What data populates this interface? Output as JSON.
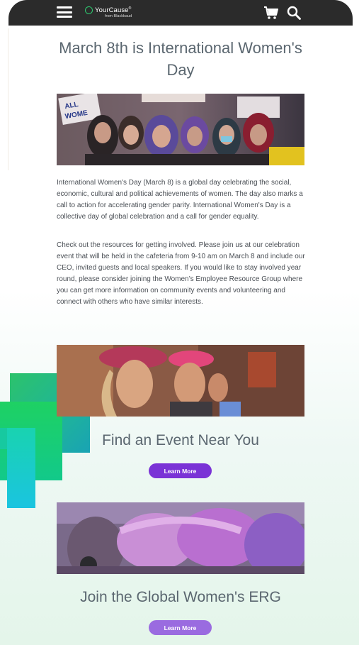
{
  "header": {
    "logo_main": "YourCause",
    "logo_reg": "®",
    "logo_sub": "from Blackbaud",
    "menu_icon": "hamburger-icon",
    "cart_icon": "cart-icon",
    "search_icon": "search-icon"
  },
  "hero": {
    "headline": "March 8th is International Women's Day"
  },
  "body": {
    "paragraph1": "International Women's Day (March 8) is a global day celebrating the social, economic, cultural and political achievements of women. The day also marks a call to action for accelerating gender parity. International Women's Day is a collective day of global celebration and a call for gender equality.",
    "paragraph2": "Check out the resources for getting involved. Please join us at our celebration event that will be held in the cafeteria from 9-10 am on March 8 and include our CEO, invited guests and local speakers. If you would like to stay involved year round, please consider joining the Women’s Employee Resource Group where you can get more information on community events and volunteering and connect with others who have similar interests."
  },
  "cards": [
    {
      "title": "Find an Event Near You",
      "button_label": "Learn More"
    },
    {
      "title": "Join the Global Women's ERG",
      "button_label": "Learn More"
    }
  ],
  "colors": {
    "header_bg": "#2b2b2b",
    "heading_text": "#5b6770",
    "primary_button": "#7a33d6",
    "secondary_button": "#9a6be0",
    "accent_green": "#2ecc71"
  }
}
